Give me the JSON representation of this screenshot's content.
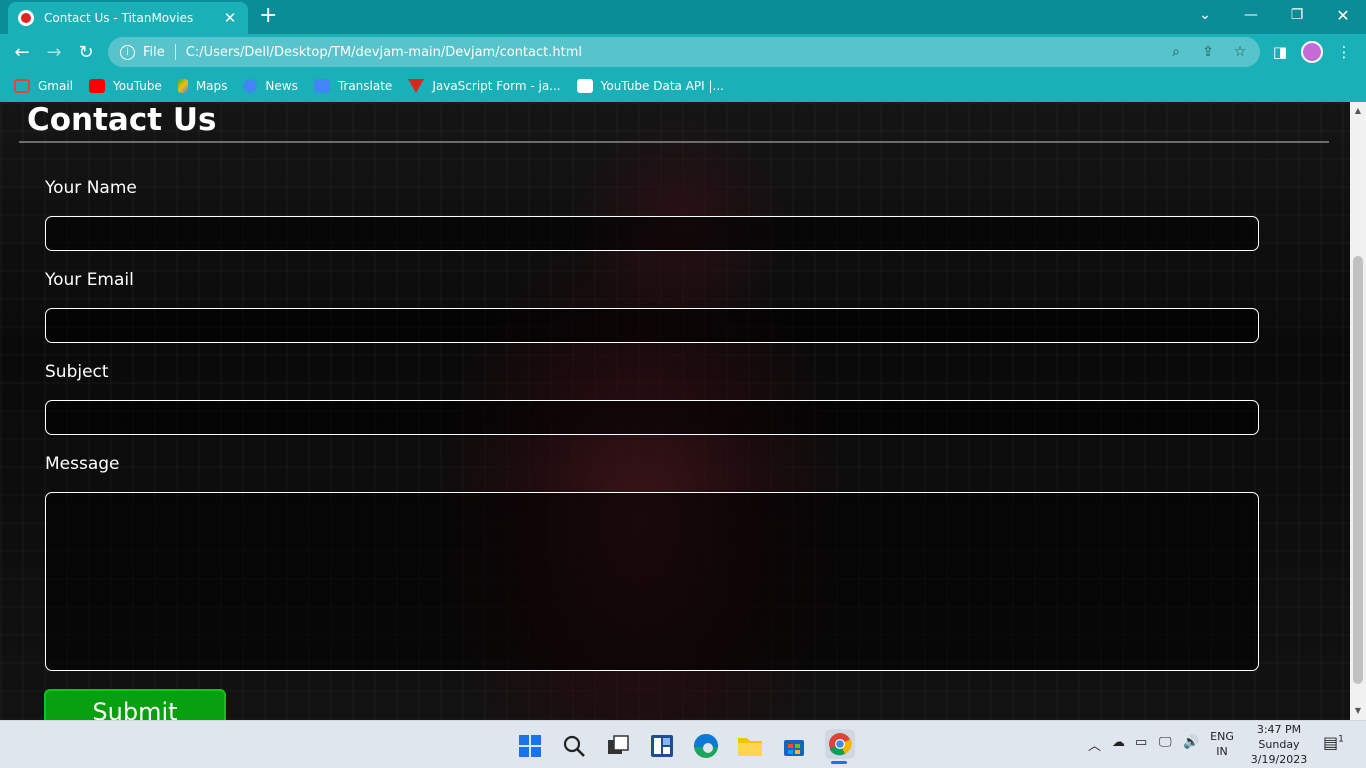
{
  "browser": {
    "tab_title": "Contact Us - TitanMovies",
    "tab_close": "✕",
    "new_tab": "+",
    "url_scheme_label": "File",
    "url": "C:/Users/Dell/Desktop/TM/devjam-main/Devjam/contact.html",
    "bookmarks": [
      {
        "label": "Gmail",
        "icon": "gmail-icon",
        "color": "#ea4335"
      },
      {
        "label": "YouTube",
        "icon": "youtube-icon",
        "color": "#ff0000"
      },
      {
        "label": "Maps",
        "icon": "maps-icon",
        "color": "#34a853"
      },
      {
        "label": "News",
        "icon": "news-icon",
        "color": "#4285f4"
      },
      {
        "label": "Translate",
        "icon": "translate-icon",
        "color": "#4285f4"
      },
      {
        "label": "JavaScript Form - ja...",
        "icon": "javascript-form-icon",
        "color": "#d9251d"
      },
      {
        "label": "YouTube Data API |...",
        "icon": "youtube-data-api-icon",
        "color": "#ffffff"
      }
    ]
  },
  "page": {
    "heading": "Contact Us",
    "form": {
      "name_label": "Your Name",
      "name_value": "",
      "email_label": "Your Email",
      "email_value": "",
      "subject_label": "Subject",
      "subject_value": "",
      "message_label": "Message",
      "message_value": "",
      "submit_label": "Submit"
    },
    "colors": {
      "submit_bg": "#06a010",
      "chrome_accent": "#1ab0b8"
    }
  },
  "taskbar": {
    "language": "ENG",
    "region": "IN",
    "time": "3:47 PM",
    "day": "Sunday",
    "date": "3/19/2023",
    "notification_count": "1"
  }
}
